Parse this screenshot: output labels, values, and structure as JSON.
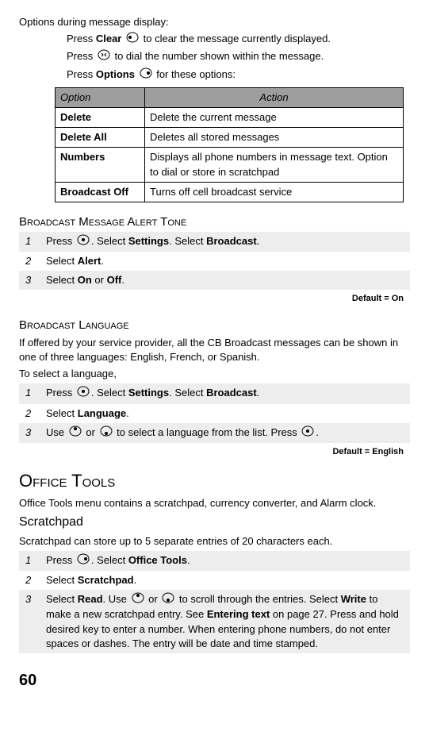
{
  "intro": {
    "heading": "Options during message display:",
    "line1_prefix": "Press ",
    "line1_bold": "Clear",
    "line1_suffix": " to clear the message currently displayed.",
    "line2_prefix": "Press ",
    "line2_suffix": " to dial the number shown within the message.",
    "line3_prefix": "Press ",
    "line3_bold": "Options",
    "line3_suffix": " for these options:"
  },
  "options_table": {
    "headers": {
      "col1": "Option",
      "col2": "Action"
    },
    "rows": [
      {
        "name": "Delete",
        "action": "Delete the current message"
      },
      {
        "name": "Delete All",
        "action": "Deletes all stored messages"
      },
      {
        "name": "Numbers",
        "action": "Displays all phone numbers in message text. Option to dial or store in scratchpad"
      },
      {
        "name": "Broadcast Off",
        "action": "Turns off cell broadcast service"
      }
    ]
  },
  "broadcast_alert": {
    "title": "Broadcast Message Alert Tone",
    "steps": [
      {
        "parts": [
          "Press ",
          "@icon-center",
          ". Select  ",
          "@b:Settings",
          ". Select  ",
          "@b:Broadcast",
          "."
        ]
      },
      {
        "parts": [
          "Select  ",
          "@b:Alert",
          "."
        ]
      },
      {
        "parts": [
          "Select  ",
          "@b:On",
          " or  ",
          "@b:Off",
          "."
        ]
      }
    ],
    "default": "Default = On"
  },
  "broadcast_lang": {
    "title": "Broadcast Language",
    "para": "If offered by your service provider, all the CB Broadcast messages can be shown in one of three languages:  English, French, or Spanish.",
    "lead": "To select a language,",
    "steps": [
      {
        "parts": [
          "Press ",
          "@icon-center",
          ". Select  ",
          "@b:Settings",
          ". Select  ",
          "@b:Broadcast",
          "."
        ]
      },
      {
        "parts": [
          "Select  ",
          "@b:Language",
          "."
        ]
      },
      {
        "parts": [
          "Use ",
          "@icon-up",
          " or ",
          "@icon-down",
          " to select a language from the list. Press ",
          "@icon-center",
          "."
        ]
      }
    ],
    "default": "Default = English"
  },
  "office_tools": {
    "title": "Office Tools",
    "intro": "Office Tools menu contains a scratchpad, currency converter, and Alarm clock.",
    "sub": "Scratchpad",
    "sub_intro": "Scratchpad can store up to 5 separate entries of 20 characters each.",
    "steps": [
      {
        "parts": [
          "Press ",
          "@icon-right",
          ". Select  ",
          "@b:Office Tools",
          "."
        ]
      },
      {
        "parts": [
          "Select  ",
          "@b:Scratchpad",
          "."
        ]
      },
      {
        "parts": [
          "Select  ",
          "@b:Read",
          ". Use ",
          "@icon-up",
          " or ",
          "@icon-down",
          " to scroll through the entries. Select  ",
          "@b:Write",
          " to make a new scratchpad entry. See ",
          "@b:Entering text",
          " on page 27. Press and hold desired key to enter a number. When entering phone numbers, do not enter spaces or dashes. The entry will be date and time stamped."
        ]
      }
    ]
  },
  "page_number": "60"
}
